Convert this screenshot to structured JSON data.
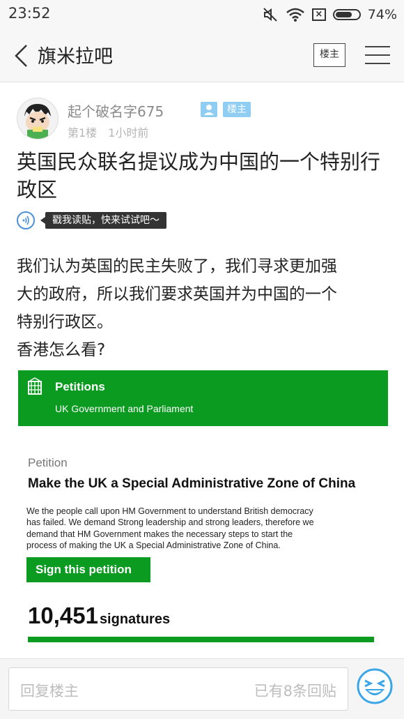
{
  "status_bar": {
    "time": "23:52",
    "battery": "74%",
    "battery_level": 0.74,
    "icons": [
      "mute-icon",
      "wifi-icon",
      "no-sim-icon",
      "battery-icon"
    ]
  },
  "nav": {
    "title": "旗米拉吧",
    "owner_button": "楼主",
    "icons": [
      "back-icon",
      "menu-icon"
    ]
  },
  "post": {
    "username": "起个破名字675",
    "badge": "楼主",
    "floor": "第1楼",
    "time_ago": "1小时前",
    "title": "英国民众联名提议成为中国的一个特别行政区",
    "listen_tip": "戳我读贴，快来试试吧～",
    "body_lines": [
      "我们认为英国的民主失败了，我们寻求更加强",
      "大的政府，所以我们要求英国并为中国的一个",
      "特别行政区。",
      "香港怎么看?"
    ]
  },
  "petition": {
    "header_title": "Petitions",
    "header_sub": "UK Government and Parliament",
    "label": "Petition",
    "heading": "Make the UK a Special Administrative Zone of China",
    "desc_lines": [
      "We the people call upon HM Government to understand British democracy",
      "has failed. We demand Strong leadership and strong leaders, therefore we",
      "demand that HM Government makes the necessary steps to start the",
      "process of making the UK a Special Administrative Zone of China."
    ],
    "sign_button": "Sign this petition",
    "count": "10,451",
    "count_unit": "signatures"
  },
  "reply": {
    "placeholder": "回复楼主",
    "reply_count": "已有8条回贴",
    "emoji_icon": "smiley-icon"
  },
  "colors": {
    "green": "#0b9b20",
    "badge_blue": "#8fcdf2",
    "listen_blue": "#4a90d9"
  }
}
